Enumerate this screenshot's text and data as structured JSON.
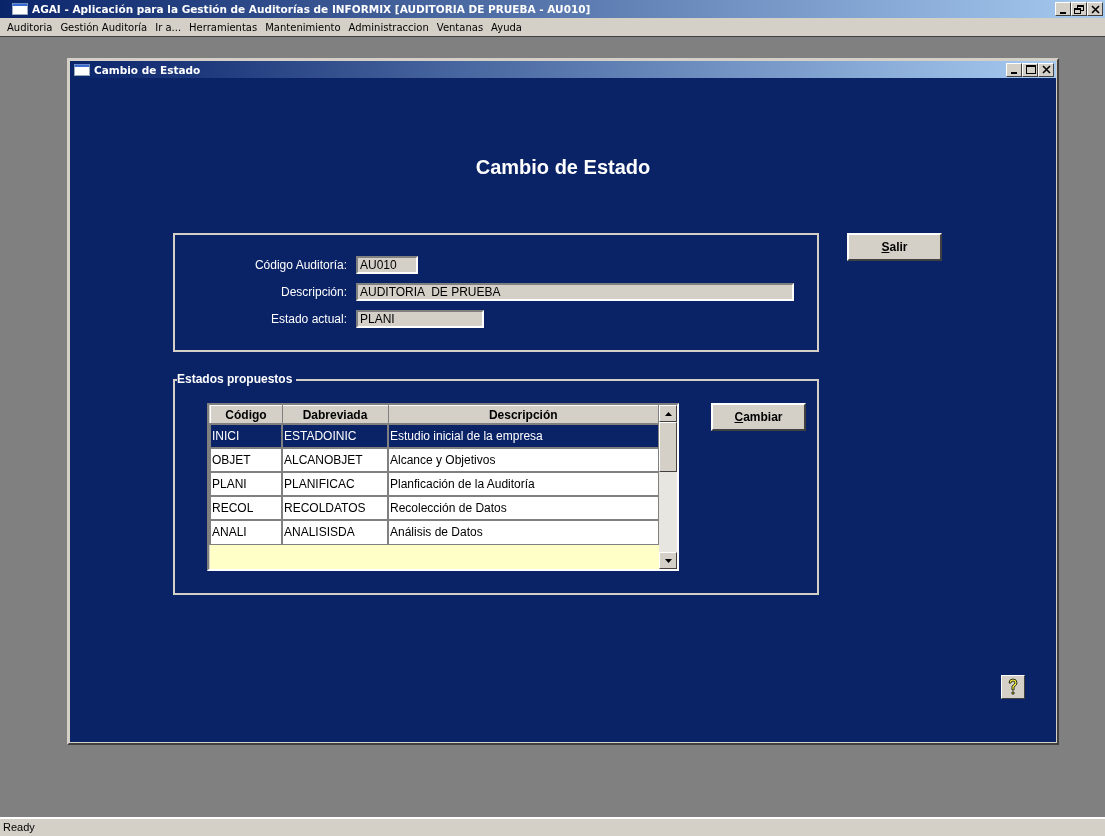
{
  "window": {
    "title": "AGAI - Aplicación para la Gestión de Auditorías de INFORMIX  [AUDITORIA  DE PRUEBA - AU010]"
  },
  "menu": [
    "Auditoria",
    "Gestión Auditoría",
    "Ir a...",
    "Herramientas",
    "Mantenimiento",
    "Administraccion",
    "Ventanas",
    "Ayuda"
  ],
  "child_window": {
    "title": "Cambio de Estado",
    "heading": "Cambio de Estado",
    "fields": [
      {
        "label": "Código Auditoría:",
        "value": "AU010",
        "kind": "short"
      },
      {
        "label": "Descripción:",
        "value": "AUDITORIA  DE PRUEBA",
        "kind": "long"
      },
      {
        "label": "Estado actual:",
        "value": "PLANI",
        "kind": "medium"
      }
    ],
    "exit_button": {
      "label": "Salir",
      "first_letter_underlined": true
    },
    "group": {
      "title": "Estados propuestos",
      "table": {
        "columns": [
          "Código",
          "Dabreviada",
          "Descripción"
        ],
        "rows": [
          {
            "cells": [
              "INICI",
              "ESTADOINIC",
              "Estudio inicial de la empresa"
            ],
            "selected": true
          },
          {
            "cells": [
              "OBJET",
              "ALCANOBJET",
              "Alcance y Objetivos"
            ],
            "selected": false
          },
          {
            "cells": [
              "PLANI",
              "PLANIFICAC",
              "Planficación de la Auditoría"
            ],
            "selected": false
          },
          {
            "cells": [
              "RECOL",
              "RECOLDATOS",
              "Recolección de Datos"
            ],
            "selected": false
          },
          {
            "cells": [
              "ANALI",
              "ANALISISDA",
              "Análisis de Datos"
            ],
            "selected": false
          }
        ]
      },
      "change_button": {
        "label": "Cambiar",
        "first_letter_underlined": true
      }
    }
  },
  "status_bar": "Ready"
}
